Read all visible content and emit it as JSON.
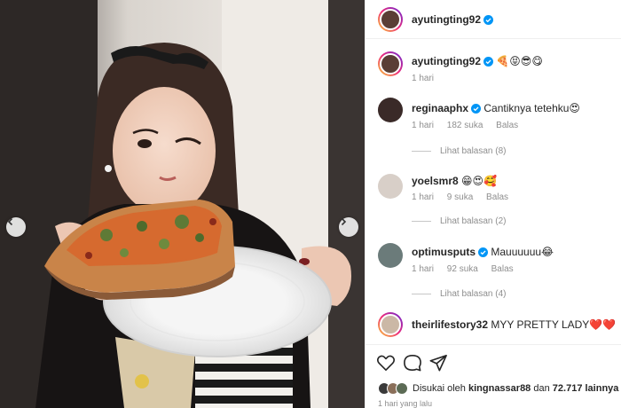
{
  "post": {
    "author": "ayutingting92"
  },
  "caption": {
    "username": "ayutingting92",
    "emoji_text": "🍕😝😎😋",
    "time": "1 hari"
  },
  "comments": [
    {
      "username": "reginaaphx",
      "verified": true,
      "text": "Cantiknya tetehku😍",
      "time": "1 hari",
      "likes": "182 suka",
      "reply_label": "Balas",
      "view_replies": "Lihat balasan (8)"
    },
    {
      "username": "yoelsmr8",
      "verified": false,
      "text": "😁😍🥰",
      "time": "1 hari",
      "likes": "9 suka",
      "reply_label": "Balas",
      "view_replies": "Lihat balasan (2)"
    },
    {
      "username": "optimusputs",
      "verified": true,
      "text": "Mauuuuuu😂",
      "time": "1 hari",
      "likes": "92 suka",
      "reply_label": "Balas",
      "view_replies": "Lihat balasan (4)"
    },
    {
      "username": "theirlifestory32",
      "verified": false,
      "text": "MYY PRETTY LADY❤️❤️"
    }
  ],
  "likes_bar": {
    "prefix": "Disukai oleh",
    "user": "kingnassar88",
    "middle": "dan",
    "count": "72.717 lainnya"
  },
  "time_ago": "1 hari yang lalu",
  "icons": [
    "heart-icon",
    "comment-icon",
    "share-icon",
    "chevron-left-icon",
    "chevron-right-icon",
    "verified-badge-icon"
  ],
  "colors": {
    "verified": "#0095f6",
    "muted": "#8e8e8e",
    "text": "#262626"
  }
}
